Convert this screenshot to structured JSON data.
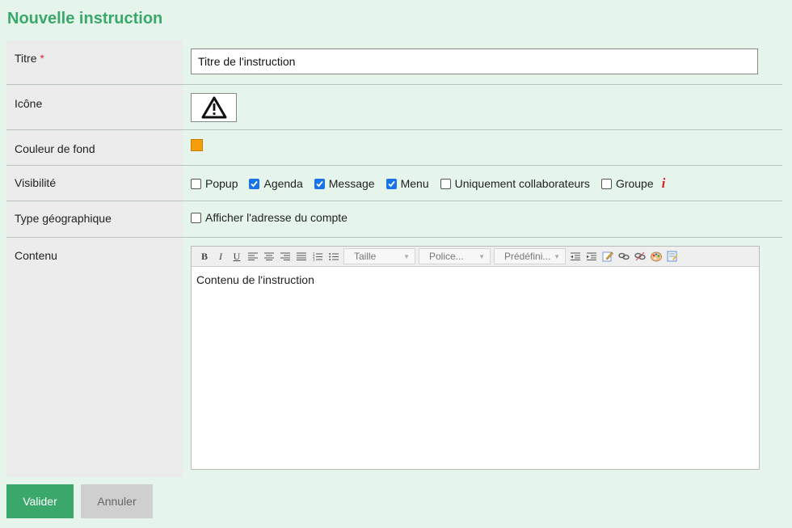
{
  "page_title": "Nouvelle instruction",
  "required_marker": "*",
  "fields": {
    "titre": {
      "label": "Titre",
      "value": "Titre de l'instruction"
    },
    "icone": {
      "label": "Icône",
      "icon": "warning-triangle-icon"
    },
    "couleur": {
      "label": "Couleur de fond",
      "color": "#f59d0b"
    },
    "visibilite": {
      "label": "Visibilité",
      "options": [
        {
          "label": "Popup",
          "checked": false
        },
        {
          "label": "Agenda",
          "checked": true
        },
        {
          "label": "Message",
          "checked": true
        },
        {
          "label": "Menu",
          "checked": true
        },
        {
          "label": "Uniquement collaborateurs",
          "checked": false
        },
        {
          "label": "Groupe",
          "checked": false
        }
      ],
      "info": "i"
    },
    "type_geo": {
      "label": "Type géographique",
      "option": {
        "label": "Afficher l'adresse du compte",
        "checked": false
      }
    },
    "contenu": {
      "label": "Contenu",
      "toolbar": {
        "bold": "B",
        "italic": "I",
        "underline": "U",
        "size_select": "Taille",
        "font_select": "Police...",
        "preset_select": "Prédéfini..."
      },
      "value": "Contenu de l'instruction"
    }
  },
  "buttons": {
    "submit": "Valider",
    "cancel": "Annuler"
  },
  "colors": {
    "accent": "#3aa86a",
    "checkbox": "#1a73e8",
    "info": "#dd2222"
  }
}
